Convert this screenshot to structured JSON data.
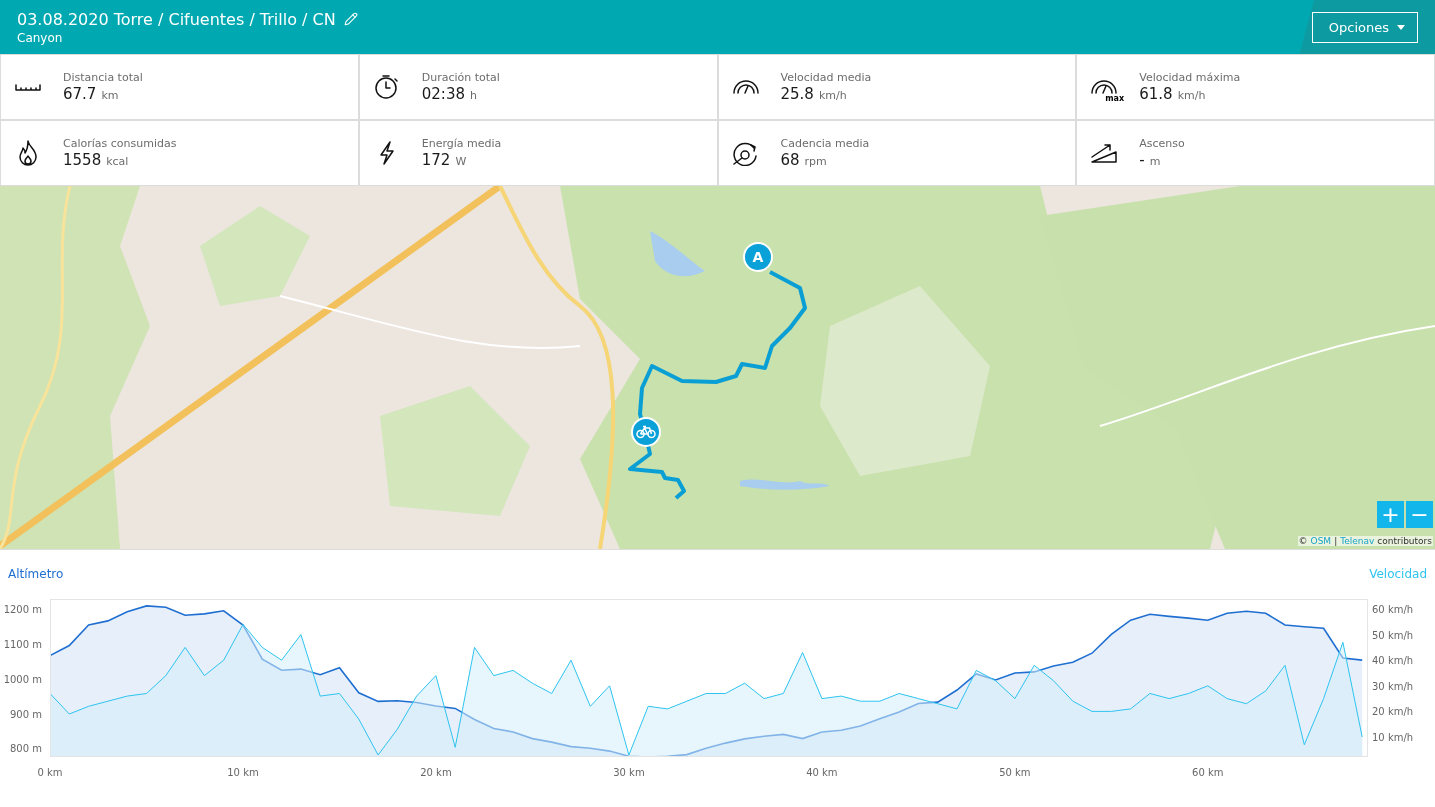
{
  "header": {
    "title": "03.08.2020 Torre / Cifuentes / Trillo / CN",
    "subtitle": "Canyon",
    "options_button": "Opciones"
  },
  "stats": [
    {
      "kind": "distance",
      "label": "Distancia total",
      "value": "67.7",
      "unit": "km"
    },
    {
      "kind": "duration",
      "label": "Duración total",
      "value": "02:38",
      "unit": "h"
    },
    {
      "kind": "avg_speed",
      "label": "Velocidad media",
      "value": "25.8",
      "unit": "km/h"
    },
    {
      "kind": "max_speed",
      "label": "Velocidad máxima",
      "value": "61.8",
      "unit": "km/h",
      "icon_text": "max"
    },
    {
      "kind": "calories",
      "label": "Calorías consumidas",
      "value": "1558",
      "unit": "kcal"
    },
    {
      "kind": "power",
      "label": "Energía media",
      "value": "172",
      "unit": "W"
    },
    {
      "kind": "cadence",
      "label": "Cadencia media",
      "value": "68",
      "unit": "rpm"
    },
    {
      "kind": "ascent",
      "label": "Ascenso",
      "value": "-",
      "unit": "m"
    }
  ],
  "map": {
    "kind": "picture",
    "markers": [
      {
        "kind": "start",
        "label": "A"
      },
      {
        "kind": "bike"
      }
    ],
    "zoom_buttons": [
      "+",
      "−"
    ],
    "attribution": {
      "prefix": "©",
      "links": [
        "OSM",
        "Telenav"
      ],
      "separator": "|",
      "suffix": "contributors"
    }
  },
  "profile": {
    "chart_data": {
      "type": "area",
      "xlim": [
        0,
        68.3
      ],
      "ylim": [
        775,
        1230
      ],
      "y2lim": [
        2.2,
        63.9
      ],
      "xticks": [
        {
          "value": 0,
          "label": "0 km"
        },
        {
          "value": 10,
          "label": "10 km"
        },
        {
          "value": 20,
          "label": "20 km"
        },
        {
          "value": 30,
          "label": "30 km"
        },
        {
          "value": 40,
          "label": "40 km"
        },
        {
          "value": 50,
          "label": "50 km"
        },
        {
          "value": 60,
          "label": "60 km"
        }
      ],
      "yticks": [
        {
          "value": 1200,
          "label": "1200 m"
        },
        {
          "value": 1100,
          "label": "1100 m"
        },
        {
          "value": 1000,
          "label": "1000 m"
        },
        {
          "value": 900,
          "label": "900 m"
        },
        {
          "value": 800,
          "label": "800 m"
        }
      ],
      "y2ticks": [
        {
          "value": 60,
          "label": "60 km/h"
        },
        {
          "value": 50,
          "label": "50 km/h"
        },
        {
          "value": 40,
          "label": "40 km/h"
        },
        {
          "value": 30,
          "label": "30 km/h"
        },
        {
          "value": 20,
          "label": "20 km/h"
        },
        {
          "value": 10,
          "label": "10 km/h"
        }
      ],
      "x": [
        0,
        1,
        2,
        3,
        4,
        5,
        6,
        7,
        8,
        9,
        10,
        11,
        12,
        13,
        14,
        15,
        16,
        17,
        18,
        19,
        20,
        21,
        22,
        23,
        24,
        25,
        26,
        27,
        28,
        29,
        30,
        31,
        32,
        33,
        34,
        35,
        36,
        37,
        38,
        39,
        40,
        41,
        42,
        43,
        44,
        45,
        46,
        47,
        48,
        49,
        50,
        51,
        52,
        53,
        54,
        55,
        56,
        57,
        58,
        59,
        60,
        61,
        62,
        63,
        64,
        65,
        66,
        67,
        68
      ],
      "series": [
        {
          "name": "Altímetro",
          "color": "#1f6fd1",
          "values": [
            1067,
            1096,
            1155,
            1167,
            1193,
            1210,
            1206,
            1183,
            1187,
            1196,
            1155,
            1057,
            1025,
            1028,
            1012,
            1032,
            960,
            935,
            937,
            932,
            922,
            915,
            883,
            857,
            847,
            828,
            818,
            805,
            800,
            792,
            777,
            775,
            777,
            782,
            800,
            815,
            827,
            835,
            840,
            828,
            847,
            852,
            864,
            885,
            905,
            929,
            933,
            968,
            1014,
            997,
            1017,
            1020,
            1037,
            1048,
            1074,
            1128,
            1169,
            1186,
            1180,
            1175,
            1169,
            1189,
            1195,
            1189,
            1155,
            1150,
            1146,
            1060,
            1054
          ]
        },
        {
          "name": "Velocidad",
          "color": "#2ec4f0",
          "axis": "y2",
          "values": [
            27,
            19,
            22,
            24,
            26,
            27,
            34,
            45,
            34,
            40,
            54,
            45,
            40,
            50,
            26,
            27,
            17,
            3,
            13,
            26,
            34,
            6,
            45,
            34,
            36,
            31,
            27,
            40,
            22,
            30,
            3,
            22,
            21,
            24,
            27,
            27,
            31,
            25,
            27,
            43,
            25,
            26,
            24,
            24,
            27,
            25,
            23,
            21,
            36,
            32,
            25,
            38,
            32,
            24,
            20,
            20,
            21,
            27,
            25,
            27,
            30,
            25,
            23,
            28,
            38,
            7,
            25,
            47,
            10
          ]
        }
      ]
    }
  }
}
